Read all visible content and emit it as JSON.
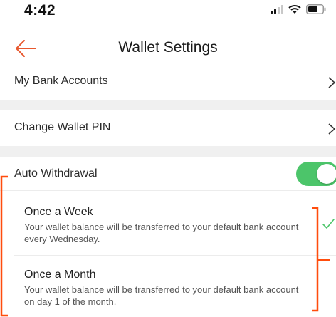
{
  "status_bar": {
    "time": "4:42",
    "icons": [
      "signal-icon",
      "wifi-icon",
      "battery-icon"
    ]
  },
  "header": {
    "title": "Wallet Settings",
    "back_icon": "back-arrow-icon"
  },
  "menu": {
    "bank_accounts": "My Bank Accounts",
    "change_pin": "Change Wallet PIN",
    "auto_withdrawal": "Auto Withdrawal",
    "auto_withdrawal_enabled": true
  },
  "options": [
    {
      "title": "Once a Week",
      "description": "Your wallet balance will be transferred to your default bank account every Wednesday.",
      "selected": true
    },
    {
      "title": "Once a Month",
      "description": "Your wallet balance will be transferred to your default bank account on day 1 of the month.",
      "selected": false
    }
  ],
  "colors": {
    "accent": "#e8582e",
    "toggle_on": "#4cc56a",
    "check": "#4cc56a",
    "annotation": "#ff4d0d",
    "separator": "#f0f0f0"
  }
}
